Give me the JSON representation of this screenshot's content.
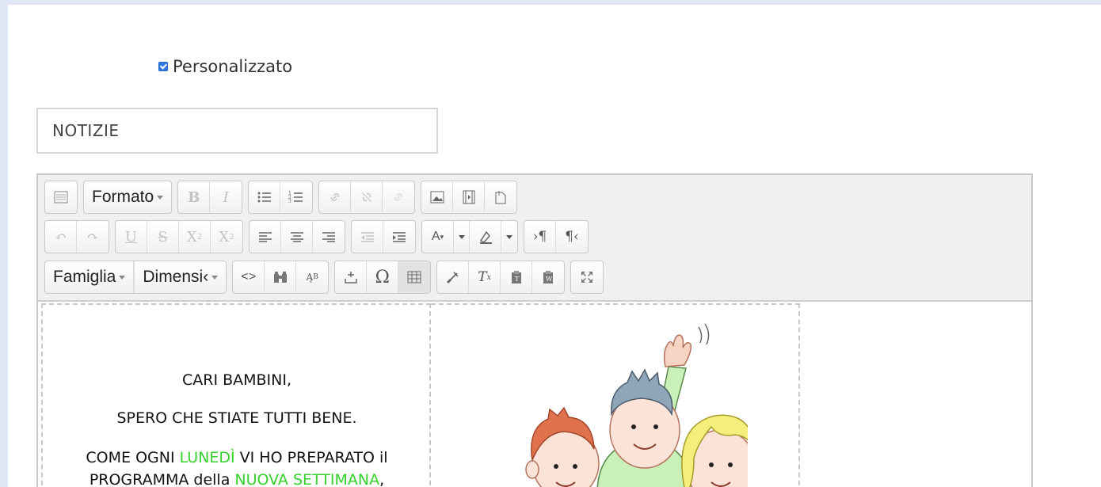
{
  "custom": {
    "label": "Personalizzato",
    "checked": true
  },
  "title_field": {
    "value": "NOTIZIE"
  },
  "toolbar": {
    "format_label": "Formato",
    "family_label": "Famiglia",
    "size_label": "Dimensi‹"
  },
  "content": {
    "line1": "CARI BAMBINI,",
    "line2": "SPERO CHE STIATE TUTTI BENE.",
    "line3_a": "COME OGNI ",
    "line3_b": "LUNEDÌ",
    "line3_c": " VI HO PREPARATO il",
    "line4_a": "PROGRAMMA della ",
    "line4_b": "NUOVA SETTIMANA",
    "line4_c": ",",
    "highlight_color": "#35d12c"
  }
}
